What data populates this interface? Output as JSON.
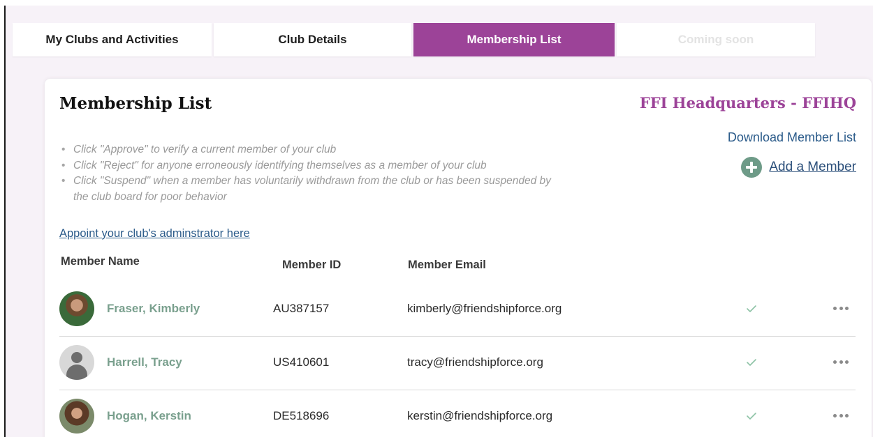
{
  "tabs": [
    {
      "label": "My Clubs and Activities"
    },
    {
      "label": "Club Details"
    },
    {
      "label": "Membership List"
    },
    {
      "label": "Coming soon"
    }
  ],
  "card": {
    "title": "Membership List",
    "club_name": "FFI Headquarters - FFIHQ",
    "download_label": "Download Member List",
    "add_member_label": "Add a Member",
    "instructions": [
      "Click \"Approve\" to verify a current member of your club",
      "Click \"Reject\" for anyone erroneously identifying themselves as a member of your club",
      "Click \"Suspend\" when a member has voluntarily withdrawn from the club or has been suspended by the club board for poor behavior"
    ],
    "appoint_link": "Appoint your club's adminstrator here"
  },
  "table": {
    "headers": {
      "name": "Member Name",
      "id": "Member ID",
      "email": "Member Email"
    },
    "rows": [
      {
        "name": "Fraser, Kimberly",
        "id": "AU387157",
        "email": "kimberly@friendshipforce.org",
        "avatar": "photo"
      },
      {
        "name": "Harrell, Tracy",
        "id": "US410601",
        "email": "tracy@friendshipforce.org",
        "avatar": "default"
      },
      {
        "name": "Hogan, Kerstin",
        "id": "DE518696",
        "email": "kerstin@friendshipforce.org",
        "avatar": "photo"
      }
    ]
  },
  "colors": {
    "accent": "#9c4398",
    "member_name": "#7aa08e",
    "link": "#2b5b8a",
    "add_icon": "#6e9b88",
    "check": "#8dc3a6"
  },
  "icons": {
    "add": "plus-circle-icon",
    "approved": "check-icon",
    "more": "more-horizontal-icon",
    "default_avatar": "person-icon"
  }
}
